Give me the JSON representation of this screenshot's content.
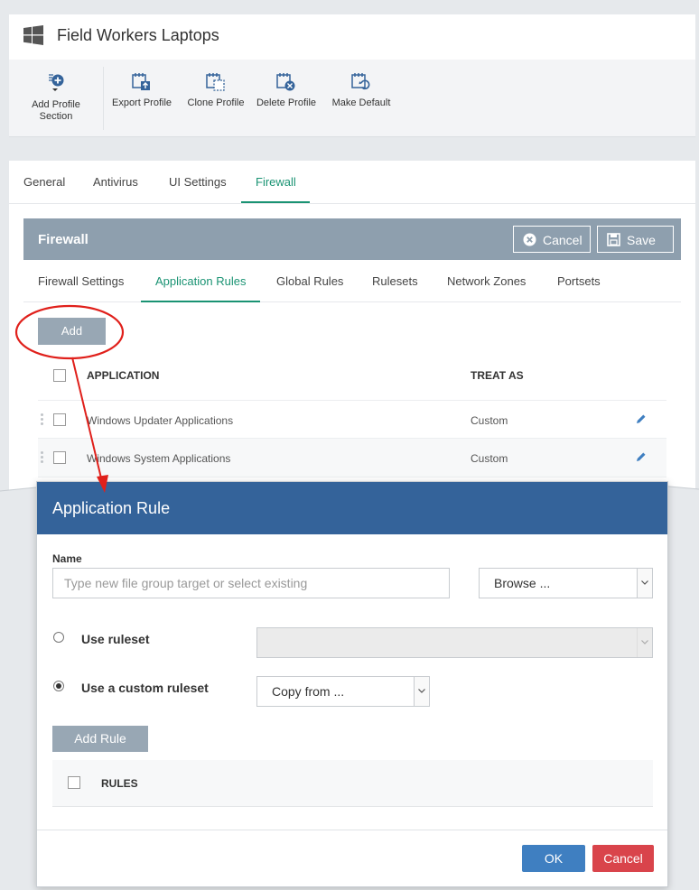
{
  "header": {
    "title": "Field Workers Laptops"
  },
  "toolbar": {
    "items": [
      {
        "label1": "Add Profile",
        "label2": "Section",
        "icon": "add-section-icon"
      },
      {
        "label": "Export Profile",
        "icon": "export-icon"
      },
      {
        "label": "Clone Profile",
        "icon": "clone-icon"
      },
      {
        "label": "Delete Profile",
        "icon": "delete-icon"
      },
      {
        "label": "Make Default",
        "icon": "default-icon"
      }
    ]
  },
  "tabs": [
    "General",
    "Antivirus",
    "UI Settings",
    "Firewall"
  ],
  "firewall": {
    "title": "Firewall",
    "cancel_label": "Cancel",
    "save_label": "Save",
    "subtabs": [
      "Firewall Settings",
      "Application Rules",
      "Global Rules",
      "Rulesets",
      "Network Zones",
      "Portsets"
    ],
    "add_label": "Add",
    "columns": {
      "application": "APPLICATION",
      "treat_as": "TREAT AS"
    },
    "rows": [
      {
        "application": "Windows Updater Applications",
        "treat_as": "Custom"
      },
      {
        "application": "Windows System Applications",
        "treat_as": "Custom"
      }
    ]
  },
  "modal": {
    "title": "Application Rule",
    "name_label": "Name",
    "name_placeholder": "Type new file group target or select existing",
    "browse_label": "Browse ...",
    "use_ruleset_label": "Use ruleset",
    "use_custom_label": "Use a custom ruleset",
    "copy_from_label": "Copy from ...",
    "add_rule_label": "Add Rule",
    "rules_header": "RULES",
    "ok_label": "OK",
    "cancel_label": "Cancel",
    "selected_option": "Use a custom ruleset"
  },
  "colors": {
    "accent_green": "#1a9373",
    "header_grey": "#8e9fae",
    "modal_blue": "#34639a",
    "ok_blue": "#3f7fc1",
    "cancel_red": "#d9444b",
    "annotation_red": "#e0201b"
  }
}
